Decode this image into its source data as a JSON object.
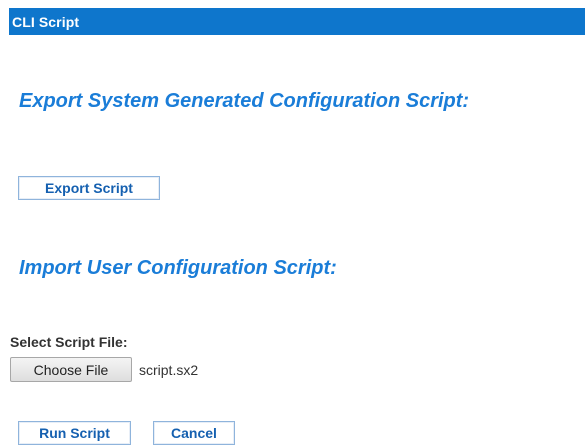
{
  "header": {
    "title": "CLI Script"
  },
  "export_section": {
    "heading": "Export System Generated Configuration Script:",
    "button_label": "Export Script"
  },
  "import_section": {
    "heading": "Import User Configuration Script:",
    "file_label": "Select Script File:",
    "choose_button_label": "Choose File",
    "selected_file": "script.sx2"
  },
  "actions": {
    "run_label": "Run Script",
    "cancel_label": "Cancel"
  },
  "colors": {
    "header_bg": "#0e76cc",
    "heading_text": "#1a7dd8",
    "button_text": "#1560b0"
  }
}
